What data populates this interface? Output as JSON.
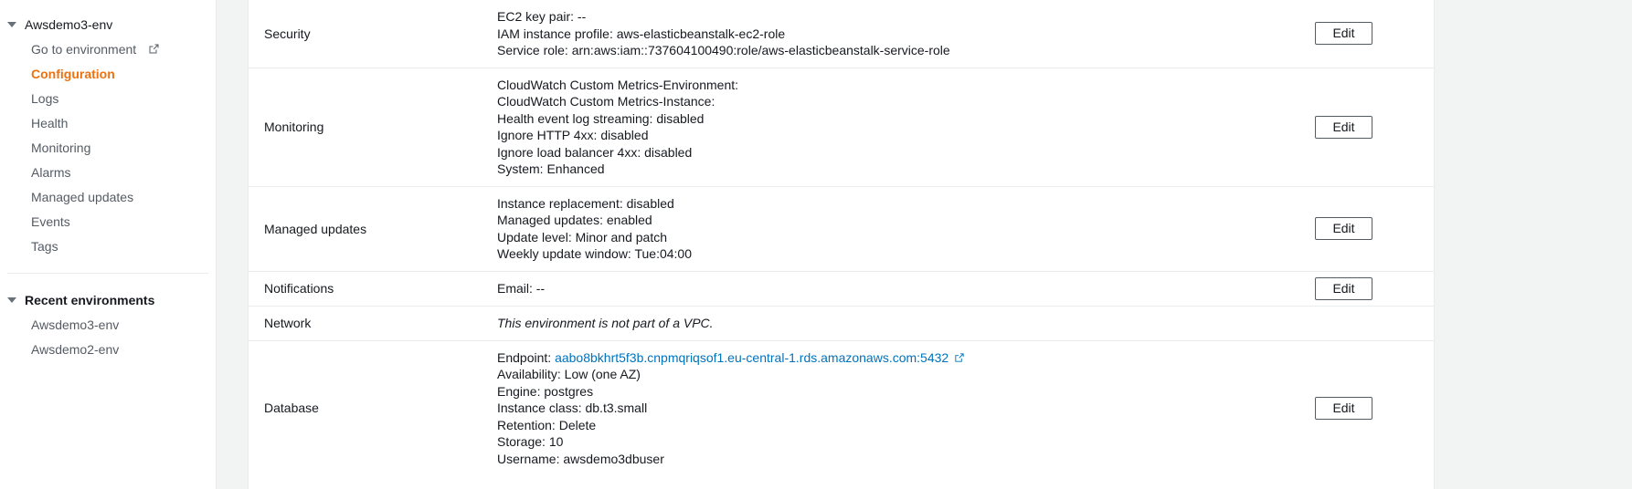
{
  "sidebar": {
    "environment_group": {
      "title": "Awsdemo3-env",
      "caret": "caret-down-icon"
    },
    "items": [
      {
        "label": "Go to environment",
        "external": true,
        "selected": false
      },
      {
        "label": "Configuration",
        "external": false,
        "selected": true
      },
      {
        "label": "Logs",
        "external": false,
        "selected": false
      },
      {
        "label": "Health",
        "external": false,
        "selected": false
      },
      {
        "label": "Monitoring",
        "external": false,
        "selected": false
      },
      {
        "label": "Alarms",
        "external": false,
        "selected": false
      },
      {
        "label": "Managed updates",
        "external": false,
        "selected": false
      },
      {
        "label": "Events",
        "external": false,
        "selected": false
      },
      {
        "label": "Tags",
        "external": false,
        "selected": false
      }
    ],
    "recent_group": {
      "title": "Recent environments",
      "caret": "caret-down-icon"
    },
    "recent_items": [
      {
        "label": "Awsdemo3-env"
      },
      {
        "label": "Awsdemo2-env"
      }
    ]
  },
  "main": {
    "edit_label": "Edit",
    "rows": [
      {
        "label": "Security",
        "lines": [
          {
            "text": "EC2 key pair: --",
            "italic": false
          },
          {
            "text": "IAM instance profile: aws-elasticbeanstalk-ec2-role",
            "italic": false
          },
          {
            "text": "Service role: arn:aws:iam::737604100490:role/aws-elasticbeanstalk-service-role",
            "italic": false
          }
        ],
        "has_edit": true
      },
      {
        "label": "Monitoring",
        "lines": [
          {
            "text": "CloudWatch Custom Metrics-Environment:",
            "italic": false
          },
          {
            "text": "CloudWatch Custom Metrics-Instance:",
            "italic": false
          },
          {
            "text": "Health event log streaming: disabled",
            "italic": false
          },
          {
            "text": "Ignore HTTP 4xx: disabled",
            "italic": false
          },
          {
            "text": "Ignore load balancer 4xx: disabled",
            "italic": false
          },
          {
            "text": "System: Enhanced",
            "italic": false
          }
        ],
        "has_edit": true
      },
      {
        "label": "Managed updates",
        "lines": [
          {
            "text": "Instance replacement: disabled",
            "italic": false
          },
          {
            "text": "Managed updates: enabled",
            "italic": false
          },
          {
            "text": "Update level: Minor and patch",
            "italic": false
          },
          {
            "text": "Weekly update window: Tue:04:00",
            "italic": false
          }
        ],
        "has_edit": true
      },
      {
        "label": "Notifications",
        "lines": [
          {
            "text": "Email: --",
            "italic": false
          }
        ],
        "has_edit": true
      },
      {
        "label": "Network",
        "lines": [
          {
            "text": "This environment is not part of a VPC.",
            "italic": true
          }
        ],
        "has_edit": false
      },
      {
        "label": "Database",
        "endpoint": {
          "prefix": "Endpoint: ",
          "link_text": "aabo8bkhrt5f3b.cnpmqriqsof1.eu-central-1.rds.amazonaws.com:5432",
          "icon": "external-link-icon"
        },
        "lines": [
          {
            "text": "Availability: Low (one AZ)",
            "italic": false
          },
          {
            "text": "Engine: postgres",
            "italic": false
          },
          {
            "text": "Instance class: db.t3.small",
            "italic": false
          },
          {
            "text": "Retention: Delete",
            "italic": false
          },
          {
            "text": "Storage: 10",
            "italic": false
          },
          {
            "text": "Username: awsdemo3dbuser",
            "italic": false
          }
        ],
        "has_edit": true
      }
    ]
  },
  "colors": {
    "accent": "#ec7211",
    "link": "#0073bb",
    "text": "#16191f",
    "muted": "#545b64",
    "border": "#e9ebed",
    "page_bg": "#f2f3f3"
  }
}
